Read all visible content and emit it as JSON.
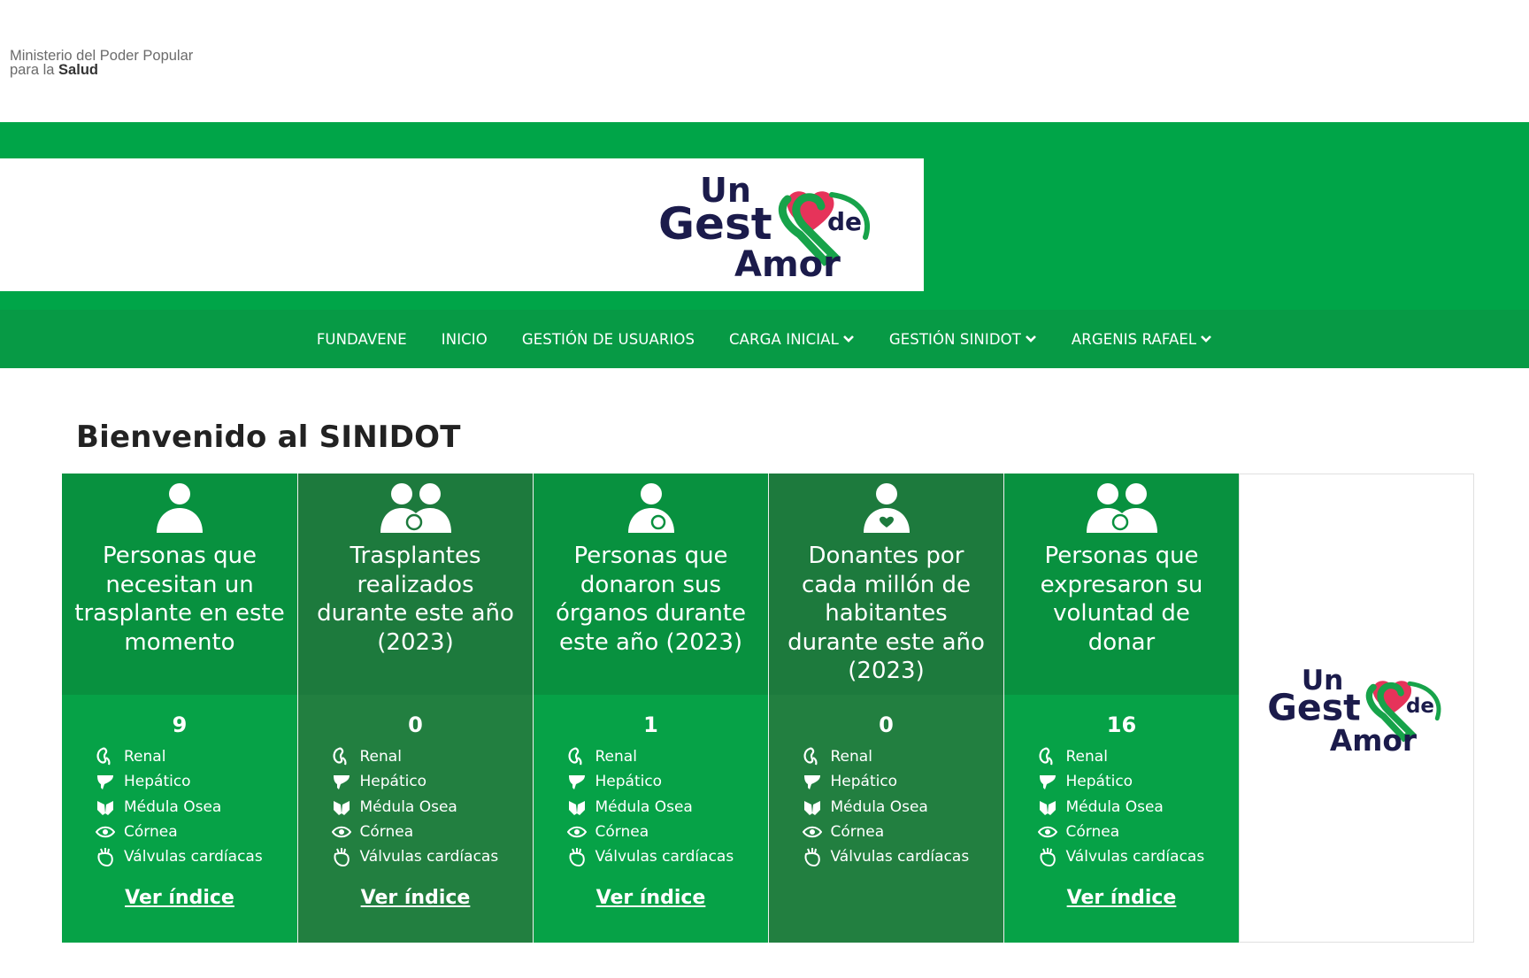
{
  "ministry": {
    "line1": "Ministerio del Poder Popular",
    "line2_prefix": "para la",
    "line2_bold": "Salud"
  },
  "brand": {
    "logo_line1": "Un",
    "logo_line2": "Gest",
    "logo_de": "de",
    "logo_line3": "Amor"
  },
  "nav": {
    "items": [
      {
        "label": "FUNDAVENE"
      },
      {
        "label": "INICIO"
      },
      {
        "label": "GESTIÓN DE USUARIOS"
      },
      {
        "label": "CARGA INICIAL"
      },
      {
        "label": "GESTIÓN SINIDOT"
      },
      {
        "label": "ARGENIS RAFAEL"
      }
    ]
  },
  "main": {
    "heading": "Bienvenido al SINIDOT"
  },
  "organs": [
    "Renal",
    "Hepático",
    "Médula Osea",
    "Córnea",
    "Válvulas cardíacas"
  ],
  "cards": [
    {
      "title": "Personas que necesitan un trasplante en este momento",
      "count": "9",
      "link": "Ver índice",
      "icon": "person-icon"
    },
    {
      "title": "Trasplantes realizados durante este año (2023)",
      "count": "0",
      "link": "Ver índice",
      "icon": "two-persons-organ-icon"
    },
    {
      "title": "Personas que donaron sus órganos durante este año (2023)",
      "count": "1",
      "link": "Ver índice",
      "icon": "person-organ-icon"
    },
    {
      "title": "Donantes por cada millón de habitantes durante este año (2023)",
      "count": "0",
      "link": "",
      "icon": "person-heart-icon"
    },
    {
      "title": "Personas que expresaron su voluntad de donar",
      "count": "16",
      "link": "Ver índice",
      "icon": "two-persons-organ-icon"
    }
  ],
  "colors": {
    "brand_green": "#00a548",
    "nav_green": "#079a45",
    "card_dark": "#1d7a3d",
    "card_mid": "#08913f",
    "logo_navy": "#1b1b4b",
    "logo_pink": "#e6335a"
  }
}
